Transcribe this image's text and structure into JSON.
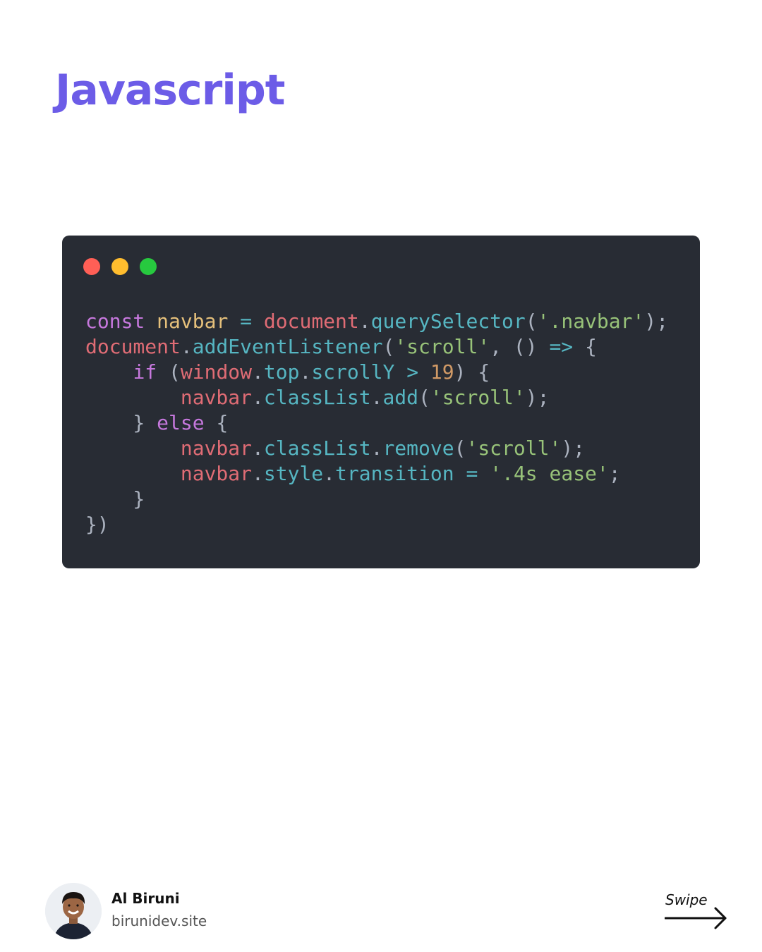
{
  "header": {
    "title": "Javascript",
    "accent_color": "#6c5ce7"
  },
  "window_controls": [
    {
      "name": "close-dot",
      "color": "#ff5f56"
    },
    {
      "name": "minimize-dot",
      "color": "#ffbd2e"
    },
    {
      "name": "maximize-dot",
      "color": "#27c93f"
    }
  ],
  "code": {
    "background": "#282c34",
    "lines": [
      [
        {
          "t": "const",
          "c": "#c678dd"
        },
        {
          "t": " ",
          "c": "#abb2bf"
        },
        {
          "t": "navbar",
          "c": "#e5c07b"
        },
        {
          "t": " = ",
          "c": "#56b6c2"
        },
        {
          "t": "document",
          "c": "#e06c75"
        },
        {
          "t": ".",
          "c": "#abb2bf"
        },
        {
          "t": "querySelector",
          "c": "#56b6c2"
        },
        {
          "t": "(",
          "c": "#abb2bf"
        },
        {
          "t": "'.navbar'",
          "c": "#98c379"
        },
        {
          "t": ");",
          "c": "#abb2bf"
        }
      ],
      [
        {
          "t": "document",
          "c": "#e06c75"
        },
        {
          "t": ".",
          "c": "#abb2bf"
        },
        {
          "t": "addEventListener",
          "c": "#56b6c2"
        },
        {
          "t": "(",
          "c": "#abb2bf"
        },
        {
          "t": "'scroll'",
          "c": "#98c379"
        },
        {
          "t": ", () ",
          "c": "#abb2bf"
        },
        {
          "t": "=>",
          "c": "#56b6c2"
        },
        {
          "t": " {",
          "c": "#abb2bf"
        }
      ],
      [
        {
          "t": "    ",
          "c": "#abb2bf"
        },
        {
          "t": "if",
          "c": "#c678dd"
        },
        {
          "t": " (",
          "c": "#abb2bf"
        },
        {
          "t": "window",
          "c": "#e06c75"
        },
        {
          "t": ".",
          "c": "#abb2bf"
        },
        {
          "t": "top",
          "c": "#56b6c2"
        },
        {
          "t": ".",
          "c": "#abb2bf"
        },
        {
          "t": "scrollY",
          "c": "#56b6c2"
        },
        {
          "t": " > ",
          "c": "#56b6c2"
        },
        {
          "t": "19",
          "c": "#d19a66"
        },
        {
          "t": ") {",
          "c": "#abb2bf"
        }
      ],
      [
        {
          "t": "        ",
          "c": "#abb2bf"
        },
        {
          "t": "navbar",
          "c": "#e06c75"
        },
        {
          "t": ".",
          "c": "#abb2bf"
        },
        {
          "t": "classList",
          "c": "#56b6c2"
        },
        {
          "t": ".",
          "c": "#abb2bf"
        },
        {
          "t": "add",
          "c": "#56b6c2"
        },
        {
          "t": "(",
          "c": "#abb2bf"
        },
        {
          "t": "'scroll'",
          "c": "#98c379"
        },
        {
          "t": ");",
          "c": "#abb2bf"
        }
      ],
      [
        {
          "t": "    } ",
          "c": "#abb2bf"
        },
        {
          "t": "else",
          "c": "#c678dd"
        },
        {
          "t": " {",
          "c": "#abb2bf"
        }
      ],
      [
        {
          "t": "        ",
          "c": "#abb2bf"
        },
        {
          "t": "navbar",
          "c": "#e06c75"
        },
        {
          "t": ".",
          "c": "#abb2bf"
        },
        {
          "t": "classList",
          "c": "#56b6c2"
        },
        {
          "t": ".",
          "c": "#abb2bf"
        },
        {
          "t": "remove",
          "c": "#56b6c2"
        },
        {
          "t": "(",
          "c": "#abb2bf"
        },
        {
          "t": "'scroll'",
          "c": "#98c379"
        },
        {
          "t": ");",
          "c": "#abb2bf"
        }
      ],
      [
        {
          "t": "        ",
          "c": "#abb2bf"
        },
        {
          "t": "navbar",
          "c": "#e06c75"
        },
        {
          "t": ".",
          "c": "#abb2bf"
        },
        {
          "t": "style",
          "c": "#56b6c2"
        },
        {
          "t": ".",
          "c": "#abb2bf"
        },
        {
          "t": "transition",
          "c": "#56b6c2"
        },
        {
          "t": " = ",
          "c": "#56b6c2"
        },
        {
          "t": "'.4s ease'",
          "c": "#98c379"
        },
        {
          "t": ";",
          "c": "#abb2bf"
        }
      ],
      [
        {
          "t": "    }",
          "c": "#abb2bf"
        }
      ],
      [
        {
          "t": "})",
          "c": "#abb2bf"
        }
      ]
    ]
  },
  "author": {
    "name": "Al Biruni",
    "site": "birunidev.site",
    "avatar_icon": "person-avatar-icon"
  },
  "swipe": {
    "label": "Swipe",
    "icon": "arrow-right-icon"
  }
}
